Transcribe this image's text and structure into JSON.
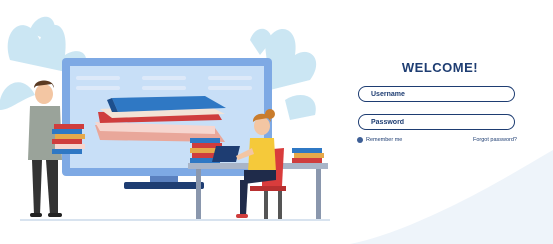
{
  "login": {
    "title": "WELCOME!",
    "username_placeholder": "Username",
    "password_placeholder": "Password",
    "remember_label": "Remember me",
    "forgot_label": "Forgot password?"
  },
  "colors": {
    "primary": "#1e3d72",
    "monitor": "#7ea9e4",
    "foliage": "#bfe0f0",
    "chair": "#d93c3c"
  }
}
